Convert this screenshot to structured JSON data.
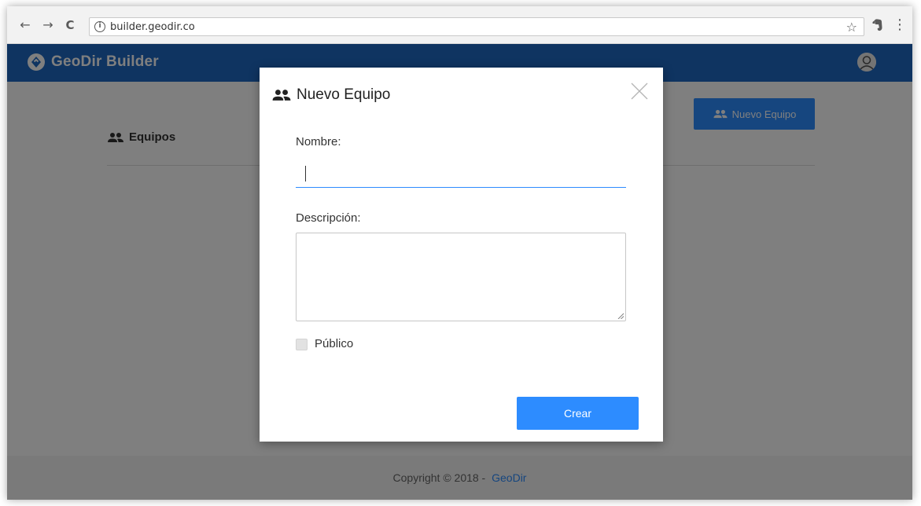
{
  "browser": {
    "url": "builder.geodir.co",
    "nav": {
      "back": "←",
      "forward": "→",
      "reload": "C"
    },
    "info_glyph": "i",
    "star": "☆",
    "menu": "⋮"
  },
  "app": {
    "brand": "GeoDir Builder",
    "section_title": "Equipos",
    "new_team_label": "Nuevo Equipo",
    "accent": "#1f68c2",
    "button_color": "#2d8cff"
  },
  "footer": {
    "copyright": "Copyright © 2018 -",
    "link": "GeoDir"
  },
  "modal": {
    "title": "Nuevo Equipo",
    "name_label": "Nombre:",
    "name_value": "",
    "description_label": "Descripción:",
    "description_value": "",
    "public_label": "Público",
    "public_checked": false,
    "submit_label": "Crear"
  },
  "icons": {
    "people": "people-icon",
    "close": "close-icon",
    "logo": "location-pin-logo",
    "avatar": "user-avatar-icon",
    "extension": "evernote-extension-icon"
  }
}
